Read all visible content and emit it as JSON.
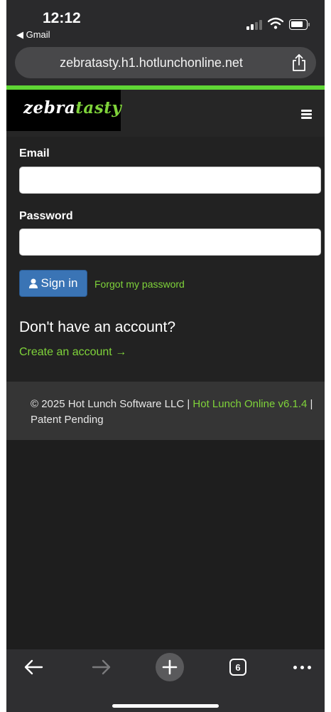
{
  "status_bar": {
    "time": "12:12",
    "back_app": "◀ Gmail",
    "icons": [
      "cellular-signal-icon",
      "wifi-icon",
      "battery-icon"
    ]
  },
  "browser": {
    "url": "zebratasty.h1.hotlunchonline.net",
    "toolbar_icons": [
      "back-arrow-icon",
      "forward-arrow-icon",
      "new-tab-plus-icon",
      "tabs-icon",
      "more-icon"
    ],
    "tab_count": "6"
  },
  "site": {
    "logo_part1": "zebra",
    "logo_part2": "tasty",
    "accent_color": "#7fd33a",
    "header_menu_icon": "hamburger-menu-icon"
  },
  "form": {
    "email_label": "Email",
    "email_value": "",
    "password_label": "Password",
    "password_value": "",
    "signin_label": "Sign in",
    "signin_icon": "user-icon",
    "button_color": "#3a74b5",
    "forgot_label": "Forgot my password",
    "no_account_heading": "Don't have an account?",
    "create_label": "Create an account →"
  },
  "footer": {
    "copyright": "© 2025 Hot Lunch Software LLC | ",
    "product_link": "Hot Lunch Online v6.1.4",
    "suffix": " | Patent Pending"
  }
}
